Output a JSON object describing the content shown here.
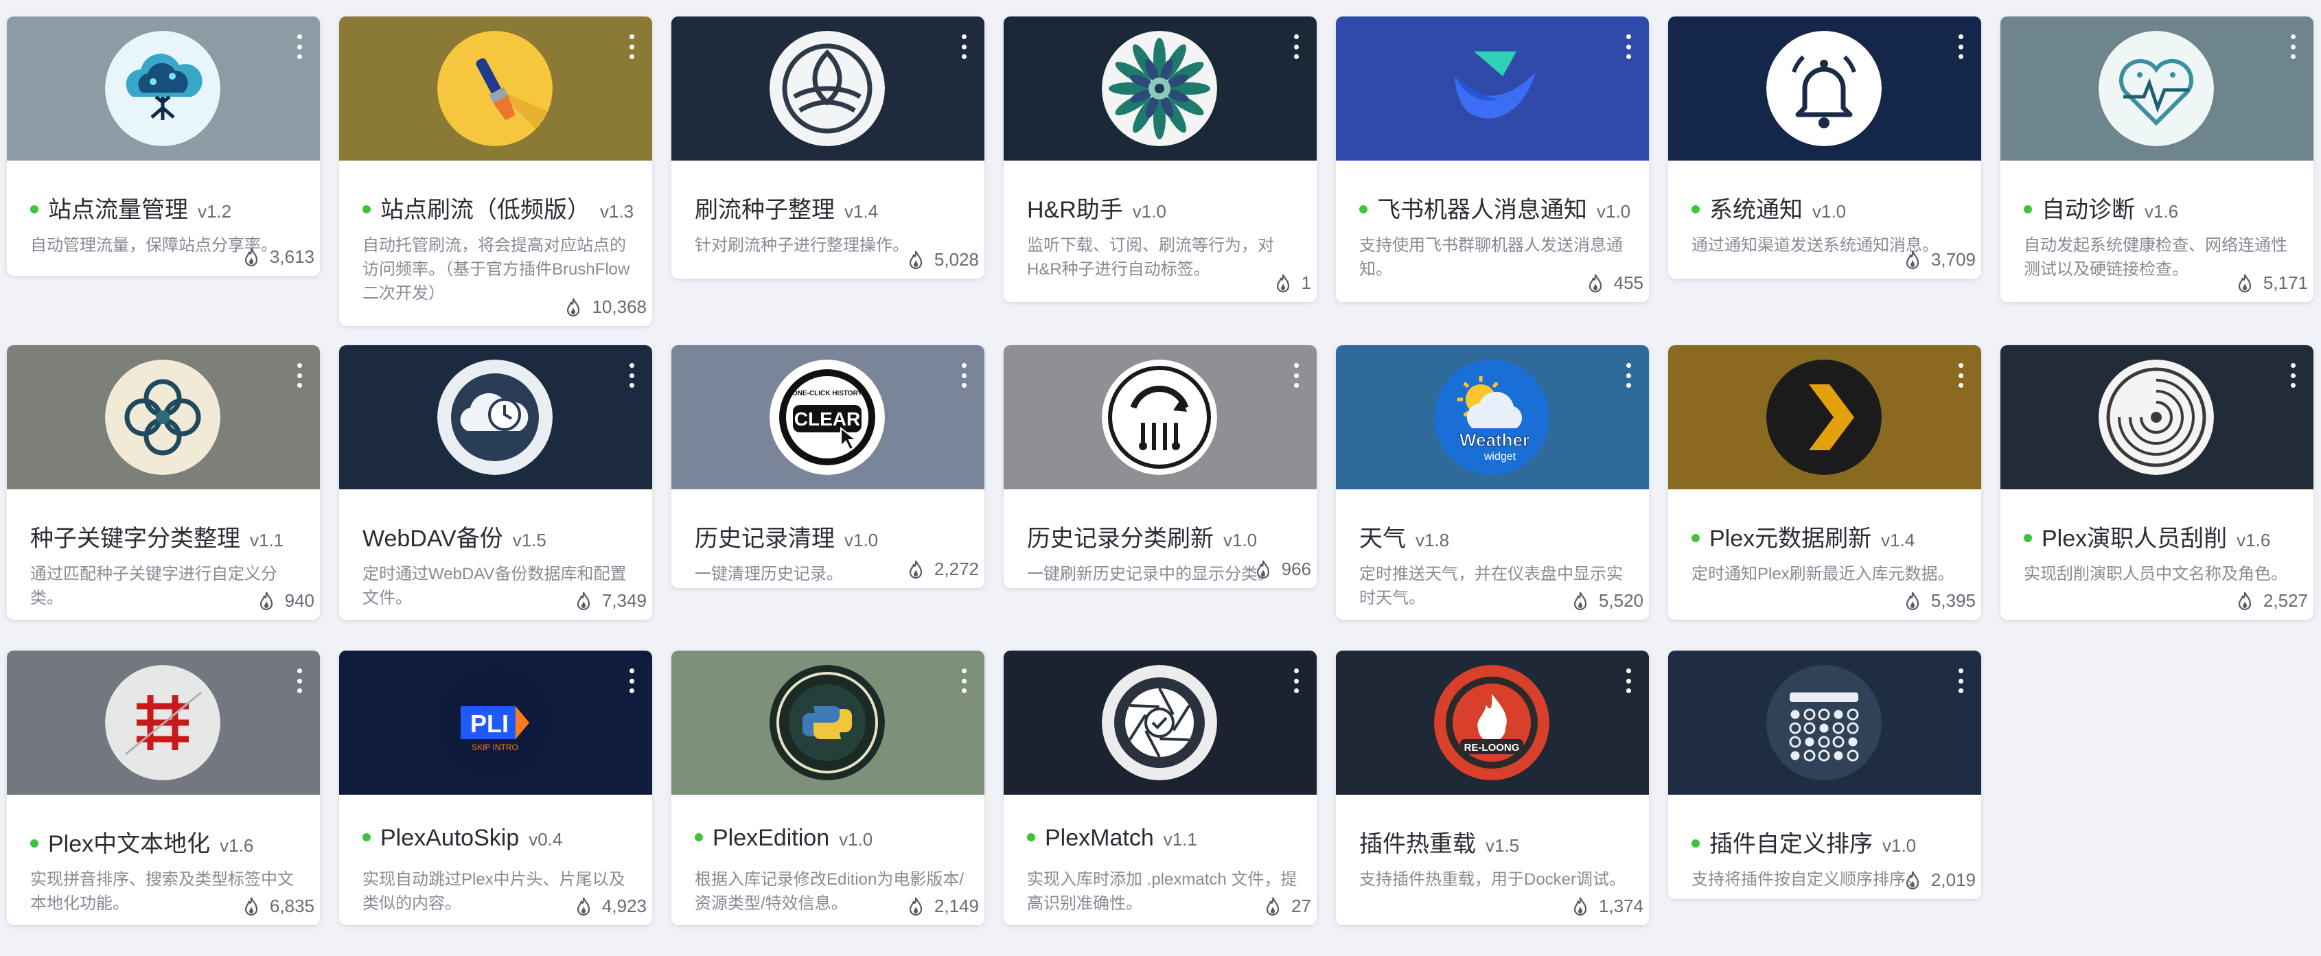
{
  "plugins": [
    {
      "title": "站点流量管理",
      "version": "v1.2",
      "desc": "自动管理流量，保障站点分享率。",
      "count": "3,613",
      "enabled": true,
      "banner_color": "#8d9ba4",
      "icon": "cloud-tree-icon"
    },
    {
      "title": "站点刷流（低频版）",
      "version": "v1.3",
      "desc": "自动托管刷流，将会提高对应站点的访问频率。（基于官方插件BrushFlow二次开发）",
      "count": "10,368",
      "enabled": true,
      "banner_color": "#8b7a35",
      "icon": "paintbrush-icon"
    },
    {
      "title": "刷流种子整理",
      "version": "v1.4",
      "desc": "针对刷流种子进行整理操作。",
      "count": "5,028",
      "enabled": false,
      "banner_color": "#1f2b3d",
      "icon": "leaf-rings-icon"
    },
    {
      "title": "H&R助手",
      "version": "v1.0",
      "desc": "监听下载、订阅、刷流等行为，对H&R种子进行自动标签。",
      "count": "1",
      "enabled": false,
      "banner_color": "#1a2838",
      "icon": "mandala-flower-icon"
    },
    {
      "title": "飞书机器人消息通知",
      "version": "v1.0",
      "desc": "支持使用飞书群聊机器人发送消息通知。",
      "count": "455",
      "enabled": true,
      "banner_color": "#2f4aa8",
      "icon": "feishu-bird-icon"
    },
    {
      "title": "系统通知",
      "version": "v1.0",
      "desc": "通过通知渠道发送系统通知消息。",
      "count": "3,709",
      "enabled": true,
      "banner_color": "#14264a",
      "icon": "bell-icon"
    },
    {
      "title": "自动诊断",
      "version": "v1.6",
      "desc": "自动发起系统健康检查、网络连通性测试以及硬链接检查。",
      "count": "5,171",
      "enabled": true,
      "banner_color": "#6f858d",
      "icon": "heart-circuit-icon"
    },
    {
      "title": "种子关键字分类整理",
      "version": "v1.1",
      "desc": "通过匹配种子关键字进行自定义分类。",
      "count": "940",
      "enabled": false,
      "banner_color": "#7d8078",
      "icon": "celtic-knot-icon"
    },
    {
      "title": "WebDAV备份",
      "version": "v1.5",
      "desc": "定时通过WebDAV备份数据库和配置文件。",
      "count": "7,349",
      "enabled": false,
      "banner_color": "#1c2a40",
      "icon": "cloud-clock-icon"
    },
    {
      "title": "历史记录清理",
      "version": "v1.0",
      "desc": "一键清理历史记录。",
      "count": "2,272",
      "enabled": false,
      "banner_color": "#7b8599",
      "icon": "clear-button-icon"
    },
    {
      "title": "历史记录分类刷新",
      "version": "v1.0",
      "desc": "一键刷新历史记录中的显示分类。",
      "count": "966",
      "enabled": false,
      "banner_color": "#8e9096",
      "icon": "circuit-refresh-icon"
    },
    {
      "title": "天气",
      "version": "v1.8",
      "desc": "定时推送天气，并在仪表盘中显示实时天气。",
      "count": "5,520",
      "enabled": false,
      "banner_color": "#2f6b9a",
      "icon": "weather-widget-icon"
    },
    {
      "title": "Plex元数据刷新",
      "version": "v1.4",
      "desc": "定时通知Plex刷新最近入库元数据。",
      "count": "5,395",
      "enabled": true,
      "banner_color": "#8a6a20",
      "icon": "plex-chevron-icon"
    },
    {
      "title": "Plex演职人员刮削",
      "version": "v1.6",
      "desc": "实现刮削演职人员中文名称及角色。",
      "count": "2,527",
      "enabled": true,
      "banner_color": "#222c38",
      "icon": "film-reel-icon"
    },
    {
      "title": "Plex中文本地化",
      "version": "v1.6",
      "desc": "实现拼音排序、搜索及类型标签中文本地化功能。",
      "count": "6,835",
      "enabled": true,
      "banner_color": "#727780",
      "icon": "chinese-glyph-icon"
    },
    {
      "title": "PlexAutoSkip",
      "version": "v0.4",
      "desc": "实现自动跳过Plex中片头、片尾以及类似的内容。",
      "count": "4,923",
      "enabled": true,
      "banner_color": "#101c3e",
      "icon": "skip-intro-icon"
    },
    {
      "title": "PlexEdition",
      "version": "v1.0",
      "desc": "根据入库记录修改Edition为电影版本/资源类型/特效信息。",
      "count": "2,149",
      "enabled": true,
      "banner_color": "#7e8f7a",
      "icon": "python-film-icon"
    },
    {
      "title": "PlexMatch",
      "version": "v1.1",
      "desc": "实现入库时添加 .plexmatch 文件，提高识别准确性。",
      "count": "27",
      "enabled": true,
      "banner_color": "#1b2230",
      "icon": "aperture-check-icon"
    },
    {
      "title": "插件热重载",
      "version": "v1.5",
      "desc": "支持插件热重载，用于Docker调试。",
      "count": "1,374",
      "enabled": false,
      "banner_color": "#1e2836",
      "icon": "reload-flame-icon"
    },
    {
      "title": "插件自定义排序",
      "version": "v1.0",
      "desc": "支持将插件按自定义顺序排序。",
      "count": "2,019",
      "enabled": true,
      "banner_color": "#1f2d44",
      "icon": "dot-grid-icon"
    }
  ],
  "colors": {
    "enabled_dot": "#3cc43c",
    "page_bg": "#f0f2f8"
  },
  "icon_label_texts": {
    "clear": "CLEAR",
    "clear_arc": "ONE-CLICK HISTORY",
    "weather_main": "Weather",
    "weather_sub": "widget",
    "skip_main": "PLI",
    "skip_sub": "SKIP INTRO",
    "reload": "RE-LOONG"
  }
}
